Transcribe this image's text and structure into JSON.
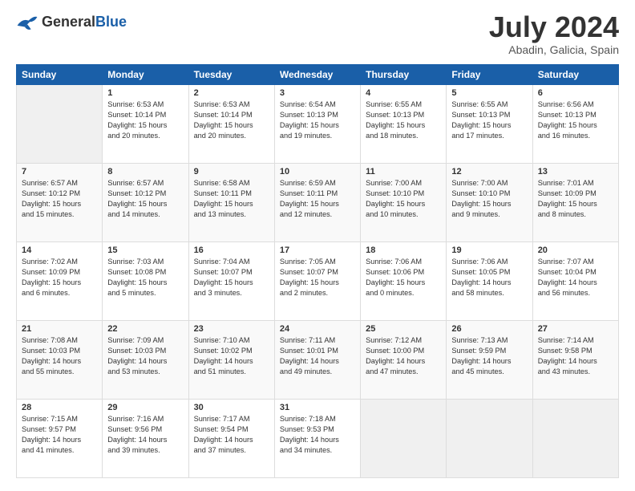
{
  "header": {
    "logo_general": "General",
    "logo_blue": "Blue",
    "month_title": "July 2024",
    "location": "Abadin, Galicia, Spain"
  },
  "days_of_week": [
    "Sunday",
    "Monday",
    "Tuesday",
    "Wednesday",
    "Thursday",
    "Friday",
    "Saturday"
  ],
  "weeks": [
    [
      {
        "day": "",
        "info": ""
      },
      {
        "day": "1",
        "info": "Sunrise: 6:53 AM\nSunset: 10:14 PM\nDaylight: 15 hours\nand 20 minutes."
      },
      {
        "day": "2",
        "info": "Sunrise: 6:53 AM\nSunset: 10:14 PM\nDaylight: 15 hours\nand 20 minutes."
      },
      {
        "day": "3",
        "info": "Sunrise: 6:54 AM\nSunset: 10:13 PM\nDaylight: 15 hours\nand 19 minutes."
      },
      {
        "day": "4",
        "info": "Sunrise: 6:55 AM\nSunset: 10:13 PM\nDaylight: 15 hours\nand 18 minutes."
      },
      {
        "day": "5",
        "info": "Sunrise: 6:55 AM\nSunset: 10:13 PM\nDaylight: 15 hours\nand 17 minutes."
      },
      {
        "day": "6",
        "info": "Sunrise: 6:56 AM\nSunset: 10:13 PM\nDaylight: 15 hours\nand 16 minutes."
      }
    ],
    [
      {
        "day": "7",
        "info": "Sunrise: 6:57 AM\nSunset: 10:12 PM\nDaylight: 15 hours\nand 15 minutes."
      },
      {
        "day": "8",
        "info": "Sunrise: 6:57 AM\nSunset: 10:12 PM\nDaylight: 15 hours\nand 14 minutes."
      },
      {
        "day": "9",
        "info": "Sunrise: 6:58 AM\nSunset: 10:11 PM\nDaylight: 15 hours\nand 13 minutes."
      },
      {
        "day": "10",
        "info": "Sunrise: 6:59 AM\nSunset: 10:11 PM\nDaylight: 15 hours\nand 12 minutes."
      },
      {
        "day": "11",
        "info": "Sunrise: 7:00 AM\nSunset: 10:10 PM\nDaylight: 15 hours\nand 10 minutes."
      },
      {
        "day": "12",
        "info": "Sunrise: 7:00 AM\nSunset: 10:10 PM\nDaylight: 15 hours\nand 9 minutes."
      },
      {
        "day": "13",
        "info": "Sunrise: 7:01 AM\nSunset: 10:09 PM\nDaylight: 15 hours\nand 8 minutes."
      }
    ],
    [
      {
        "day": "14",
        "info": "Sunrise: 7:02 AM\nSunset: 10:09 PM\nDaylight: 15 hours\nand 6 minutes."
      },
      {
        "day": "15",
        "info": "Sunrise: 7:03 AM\nSunset: 10:08 PM\nDaylight: 15 hours\nand 5 minutes."
      },
      {
        "day": "16",
        "info": "Sunrise: 7:04 AM\nSunset: 10:07 PM\nDaylight: 15 hours\nand 3 minutes."
      },
      {
        "day": "17",
        "info": "Sunrise: 7:05 AM\nSunset: 10:07 PM\nDaylight: 15 hours\nand 2 minutes."
      },
      {
        "day": "18",
        "info": "Sunrise: 7:06 AM\nSunset: 10:06 PM\nDaylight: 15 hours\nand 0 minutes."
      },
      {
        "day": "19",
        "info": "Sunrise: 7:06 AM\nSunset: 10:05 PM\nDaylight: 14 hours\nand 58 minutes."
      },
      {
        "day": "20",
        "info": "Sunrise: 7:07 AM\nSunset: 10:04 PM\nDaylight: 14 hours\nand 56 minutes."
      }
    ],
    [
      {
        "day": "21",
        "info": "Sunrise: 7:08 AM\nSunset: 10:03 PM\nDaylight: 14 hours\nand 55 minutes."
      },
      {
        "day": "22",
        "info": "Sunrise: 7:09 AM\nSunset: 10:03 PM\nDaylight: 14 hours\nand 53 minutes."
      },
      {
        "day": "23",
        "info": "Sunrise: 7:10 AM\nSunset: 10:02 PM\nDaylight: 14 hours\nand 51 minutes."
      },
      {
        "day": "24",
        "info": "Sunrise: 7:11 AM\nSunset: 10:01 PM\nDaylight: 14 hours\nand 49 minutes."
      },
      {
        "day": "25",
        "info": "Sunrise: 7:12 AM\nSunset: 10:00 PM\nDaylight: 14 hours\nand 47 minutes."
      },
      {
        "day": "26",
        "info": "Sunrise: 7:13 AM\nSunset: 9:59 PM\nDaylight: 14 hours\nand 45 minutes."
      },
      {
        "day": "27",
        "info": "Sunrise: 7:14 AM\nSunset: 9:58 PM\nDaylight: 14 hours\nand 43 minutes."
      }
    ],
    [
      {
        "day": "28",
        "info": "Sunrise: 7:15 AM\nSunset: 9:57 PM\nDaylight: 14 hours\nand 41 minutes."
      },
      {
        "day": "29",
        "info": "Sunrise: 7:16 AM\nSunset: 9:56 PM\nDaylight: 14 hours\nand 39 minutes."
      },
      {
        "day": "30",
        "info": "Sunrise: 7:17 AM\nSunset: 9:54 PM\nDaylight: 14 hours\nand 37 minutes."
      },
      {
        "day": "31",
        "info": "Sunrise: 7:18 AM\nSunset: 9:53 PM\nDaylight: 14 hours\nand 34 minutes."
      },
      {
        "day": "",
        "info": ""
      },
      {
        "day": "",
        "info": ""
      },
      {
        "day": "",
        "info": ""
      }
    ]
  ]
}
